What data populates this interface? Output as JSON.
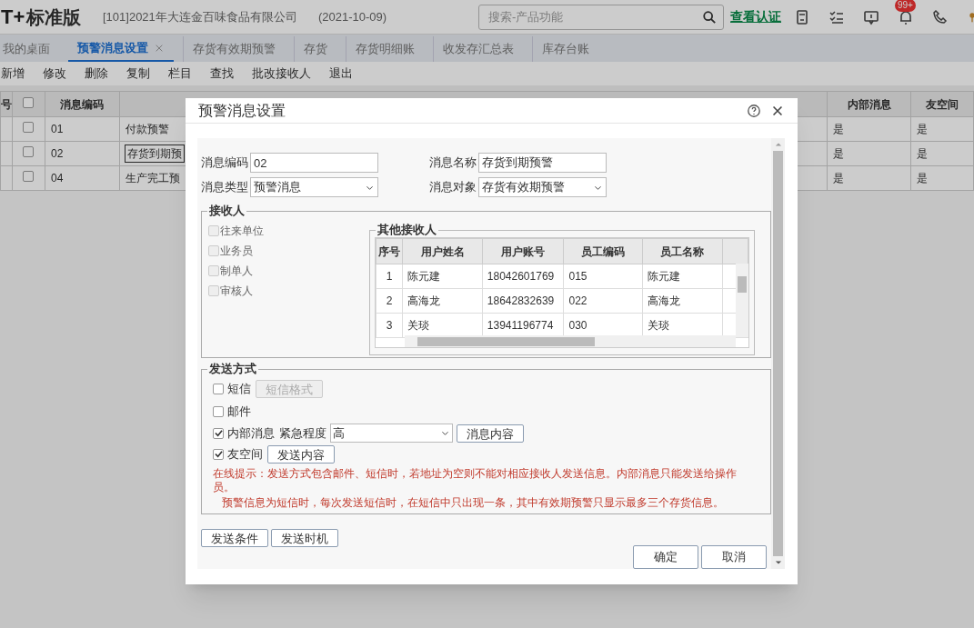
{
  "app": {
    "logo": "T+",
    "edition": "标准版",
    "company": "[101]2021年大连金百味食品有限公司",
    "date": "(2021-10-09)",
    "search_placeholder": "搜索-产品功能",
    "auth_link": "查看认证",
    "badge": "99+"
  },
  "tabs": [
    {
      "label": "我的桌面",
      "selected": false,
      "closable": false
    },
    {
      "label": "预警消息设置",
      "selected": true,
      "closable": true
    },
    {
      "label": "存货有效期预警",
      "selected": false,
      "closable": false
    },
    {
      "label": "存货",
      "selected": false,
      "closable": false
    },
    {
      "label": "存货明细账",
      "selected": false,
      "closable": false
    },
    {
      "label": "收发存汇总表",
      "selected": false,
      "closable": false
    },
    {
      "label": "库存台账",
      "selected": false,
      "closable": false
    }
  ],
  "toolbar": [
    "新增",
    "修改",
    "删除",
    "复制",
    "栏目",
    "查找",
    "批改接收人",
    "退出"
  ],
  "table": {
    "columns": [
      {
        "kind": "text",
        "label": "号"
      },
      {
        "kind": "checkbox",
        "checked": false
      },
      {
        "kind": "text",
        "label": "消息编码"
      },
      {
        "kind": "covered"
      },
      {
        "kind": "text",
        "label": "内部消息"
      },
      {
        "kind": "text",
        "label": "友空间"
      }
    ],
    "rows": [
      {
        "checked": false,
        "selected": false,
        "code": "01",
        "name": "付款预警",
        "internal": "是",
        "space": "是"
      },
      {
        "checked": false,
        "selected": true,
        "code": "02",
        "name": "存货到期预",
        "internal": "是",
        "space": "是"
      },
      {
        "checked": false,
        "selected": false,
        "code": "04",
        "name": "生产完工预",
        "internal": "是",
        "space": "是"
      }
    ]
  },
  "dialog": {
    "title": "预警消息设置",
    "fields": [
      {
        "kind": "text",
        "label": "消息编码",
        "value": "02"
      },
      {
        "kind": "text",
        "label": "消息名称",
        "value": "存货到期预警"
      },
      {
        "kind": "select",
        "label": "消息类型",
        "value": "预警消息"
      },
      {
        "kind": "select",
        "label": "消息对象",
        "value": "存货有效期预警"
      }
    ],
    "recipients": {
      "title": "接收人",
      "options": [
        {
          "label": "往来单位",
          "checked": false
        },
        {
          "label": "业务员",
          "checked": false
        },
        {
          "label": "制单人",
          "checked": false
        },
        {
          "label": "审核人",
          "checked": false
        }
      ],
      "others": {
        "title": "其他接收人",
        "columns": [
          "序号",
          "用户姓名",
          "用户账号",
          "员工编码",
          "员工名称"
        ],
        "rows": [
          [
            "1",
            "陈元建",
            "18042601769",
            "015",
            "陈元建"
          ],
          [
            "2",
            "高海龙",
            "18642832639",
            "022",
            "高海龙"
          ],
          [
            "3",
            "关琰",
            "13941196774",
            "030",
            "关琰"
          ]
        ]
      }
    },
    "send": {
      "title": "发送方式",
      "methods": [
        {
          "kind": "sms",
          "label": "短信",
          "checked": false,
          "button": "短信格式",
          "button_disabled": true
        },
        {
          "kind": "mail",
          "label": "邮件",
          "checked": false
        },
        {
          "kind": "internal",
          "label": "内部消息",
          "checked": true,
          "urgency_label": "紧急程度",
          "urgency": "高",
          "button": "消息内容"
        },
        {
          "kind": "space",
          "label": "友空间",
          "checked": true,
          "button": "发送内容"
        }
      ],
      "notes": [
        "在线提示：发送方式包含邮件、短信时，若地址为空则不能对相应接收人发送信息。内部消息只能发送给操作员。",
        "预警信息为短信时，每次发送短信时，在短信中只出现一条，其中有效期预警只显示最多三个存货信息。"
      ]
    },
    "footer_buttons": [
      "发送条件",
      "发送时机"
    ],
    "actions": [
      "确定",
      "取消"
    ]
  }
}
